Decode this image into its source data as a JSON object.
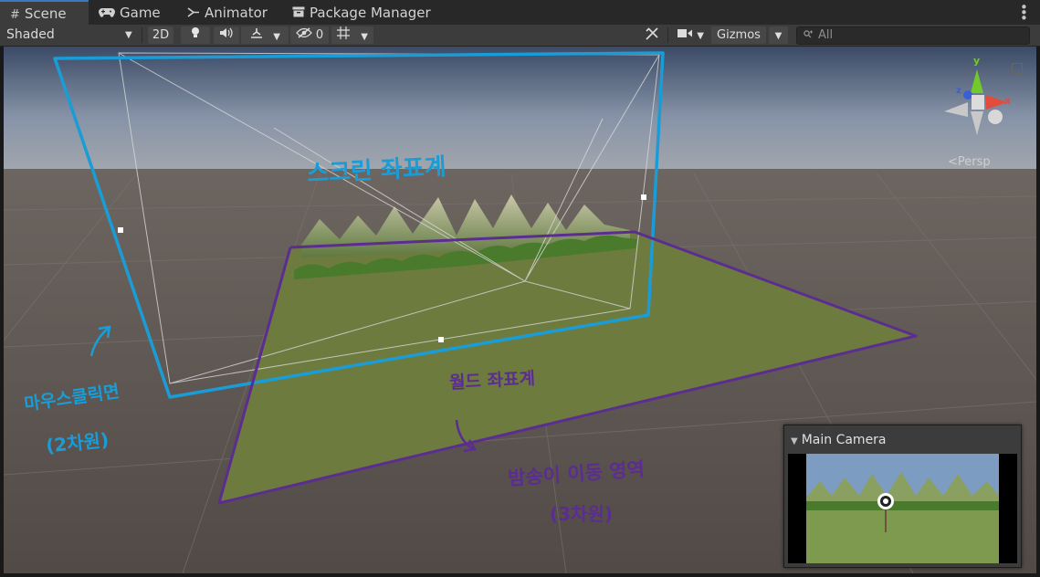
{
  "tabs": [
    {
      "label": "Scene",
      "icon": "grid-icon",
      "active": true
    },
    {
      "label": "Game",
      "icon": "gamepad-icon",
      "active": false
    },
    {
      "label": "Animator",
      "icon": "animator-icon",
      "active": false
    },
    {
      "label": "Package Manager",
      "icon": "package-icon",
      "active": false
    }
  ],
  "toolbar": {
    "shading_mode": "Shaded",
    "toggle_2d": "2D",
    "hidden_count": "0",
    "gizmos_label": "Gizmos",
    "search_placeholder": "All"
  },
  "view": {
    "projection_label": "<Persp",
    "gizmo_axes": [
      "y",
      "x",
      "z"
    ]
  },
  "annotations": {
    "screen_coords": "스크린 좌표계",
    "world_coords": "월드 좌표계",
    "mouse_click": "마우스클릭면",
    "mouse_click_dim": "(2차원)",
    "move_area": "밤송이 이동 영역",
    "move_area_dim": "(3차원)",
    "blue_color": "#1a9dd6",
    "purple_color": "#5b2d91"
  },
  "camera_preview": {
    "title": "Main Camera"
  }
}
